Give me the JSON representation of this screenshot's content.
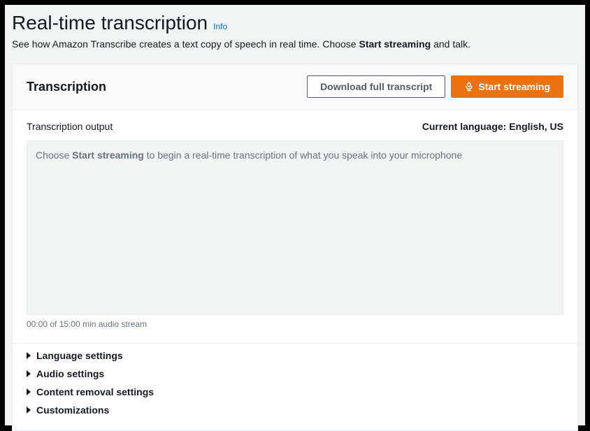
{
  "page": {
    "title": "Real-time transcription",
    "info_label": "Info",
    "description_pre": "See how Amazon Transcribe creates a text copy of speech in real time. Choose ",
    "description_bold": "Start streaming",
    "description_post": " and talk."
  },
  "panel": {
    "title": "Transcription",
    "download_label": "Download full transcript",
    "start_label": "Start streaming"
  },
  "output": {
    "label": "Transcription output",
    "language_label": "Current language: English, US",
    "placeholder_pre": "Choose ",
    "placeholder_bold": "Start streaming",
    "placeholder_post": " to begin a real-time transcription of what you speak into your microphone",
    "stream_time": "00:00 of 15:00 min audio stream"
  },
  "settings": {
    "items": [
      {
        "label": "Language settings"
      },
      {
        "label": "Audio settings"
      },
      {
        "label": "Content removal settings"
      },
      {
        "label": "Customizations"
      }
    ]
  },
  "colors": {
    "accent": "#ec7211",
    "link": "#0073bb"
  }
}
